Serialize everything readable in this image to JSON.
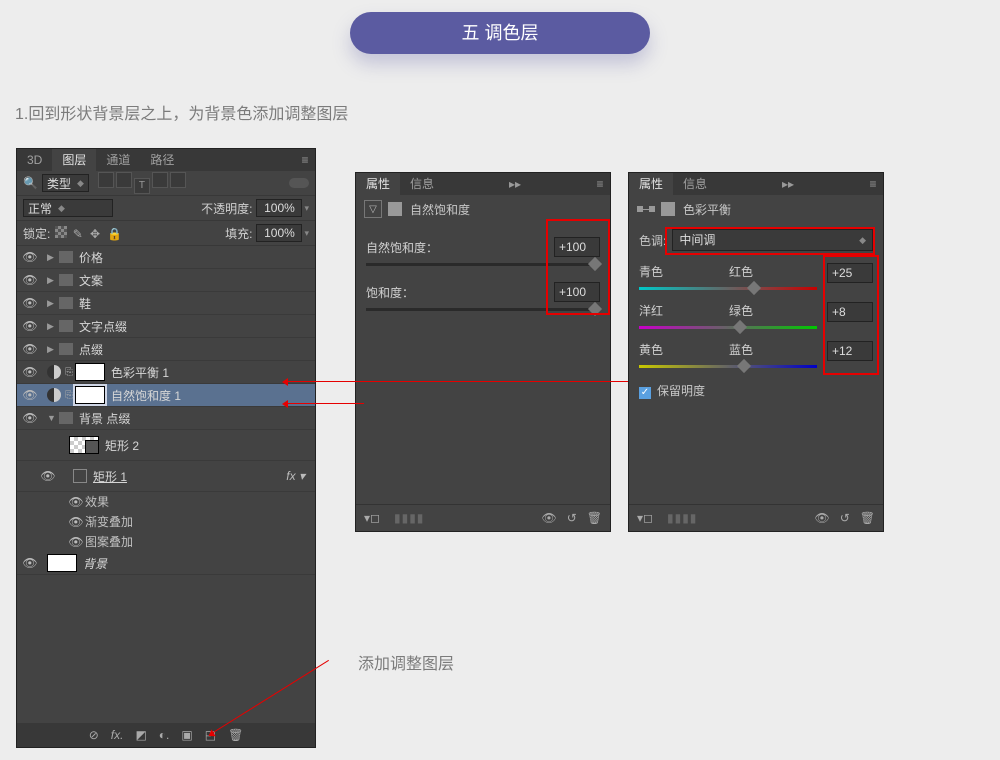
{
  "header": {
    "title": "五 调色层"
  },
  "caption": "1.回到形状背景层之上，为背景色添加调整图层",
  "note": "添加调整图层",
  "layersPanel": {
    "tabs": [
      "3D",
      "图层",
      "通道",
      "路径"
    ],
    "activeTab": 1,
    "kindLabel": "类型",
    "blendMode": "正常",
    "opacityLabel": "不透明度:",
    "opacityValue": "100%",
    "lockLabel": "锁定:",
    "fillLabel": "填充:",
    "fillValue": "100%",
    "layers": [
      {
        "type": "group",
        "name": "价格"
      },
      {
        "type": "group",
        "name": "文案"
      },
      {
        "type": "group",
        "name": "鞋"
      },
      {
        "type": "group",
        "name": "文字点缀"
      },
      {
        "type": "group",
        "name": "点缀"
      },
      {
        "type": "adj",
        "name": "色彩平衡 1"
      },
      {
        "type": "adj",
        "name": "自然饱和度 1",
        "selected": true
      },
      {
        "type": "group",
        "name": "背景 点缀",
        "open": true
      },
      {
        "type": "shape",
        "name": "矩形 2",
        "indent": 1,
        "checker": true
      },
      {
        "type": "shape",
        "name": "矩形 1",
        "indent": 1,
        "fx": true,
        "underline": true
      },
      {
        "type": "fxlabel",
        "name": "效果"
      },
      {
        "type": "fxitem",
        "name": "渐变叠加"
      },
      {
        "type": "fxitem",
        "name": "图案叠加"
      },
      {
        "type": "bg",
        "name": "背景",
        "italic": true
      }
    ]
  },
  "vibrance": {
    "tabs": [
      "属性",
      "信息"
    ],
    "title": "自然饱和度",
    "rows": [
      {
        "label": "自然饱和度：",
        "value": "+100",
        "pos": 100
      },
      {
        "label": "饱和度：",
        "value": "+100",
        "pos": 100
      }
    ]
  },
  "colorBalance": {
    "tabs": [
      "属性",
      "信息"
    ],
    "title": "色彩平衡",
    "toneLabel": "色调:",
    "toneValue": "中间调",
    "sliders": [
      {
        "left": "青色",
        "right": "红色",
        "value": "+25",
        "pos": 62
      },
      {
        "left": "洋红",
        "right": "绿色",
        "value": "+8",
        "pos": 54
      },
      {
        "left": "黄色",
        "right": "蓝色",
        "value": "+12",
        "pos": 56
      }
    ],
    "preserveLabel": "保留明度"
  }
}
